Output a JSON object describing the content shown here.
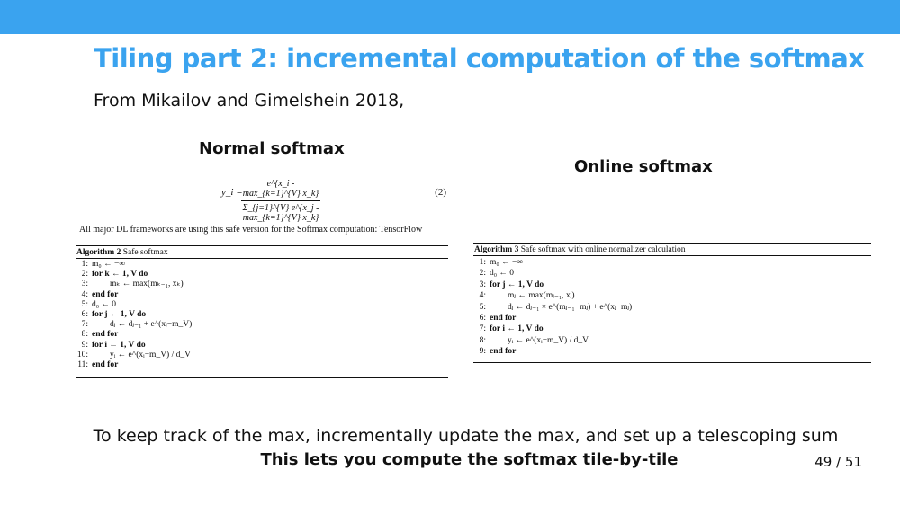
{
  "slide": {
    "title": "Tiling part 2: incremental computation of the softmax",
    "subtitle": "From Mikailov and Gimelshein 2018,",
    "left_heading": "Normal softmax",
    "right_heading": "Online softmax",
    "footer_line1": "To keep track of the max, incrementally update the max, and set up a telescoping sum",
    "footer_line2": "This lets you compute the softmax tile-by-tile",
    "page_number": "49 / 51"
  },
  "equation": {
    "lhs": "y_i =",
    "numerator": "e^{x_i - max_{k=1}^{V} x_k}",
    "denominator": "Σ_{j=1}^{V} e^{x_j - max_{k=1}^{V} x_k}",
    "number": "(2)"
  },
  "note": "All major DL frameworks are using this safe version for the Softmax computation: TensorFlow",
  "algo_left": {
    "label": "Algorithm 2",
    "caption": "Safe softmax",
    "lines": [
      {
        "n": "1:",
        "text": "m₀ ← −∞"
      },
      {
        "n": "2:",
        "text": "for k ← 1, V do"
      },
      {
        "n": "3:",
        "text": "mₖ ← max(mₖ₋₁, xₖ)"
      },
      {
        "n": "4:",
        "text": "end for"
      },
      {
        "n": "5:",
        "text": "d₀ ← 0"
      },
      {
        "n": "6:",
        "text": "for j ← 1, V do"
      },
      {
        "n": "7:",
        "text": "dⱼ ← dⱼ₋₁ + e^(xⱼ−m_V)"
      },
      {
        "n": "8:",
        "text": "end for"
      },
      {
        "n": "9:",
        "text": "for i ← 1, V do"
      },
      {
        "n": "10:",
        "text": "yᵢ ← e^(xᵢ−m_V) / d_V"
      },
      {
        "n": "11:",
        "text": "end for"
      }
    ]
  },
  "algo_right": {
    "label": "Algorithm 3",
    "caption": "Safe softmax with online normalizer calculation",
    "lines": [
      {
        "n": "1:",
        "text": "m₀ ← −∞"
      },
      {
        "n": "2:",
        "text": "d₀ ← 0"
      },
      {
        "n": "3:",
        "text": "for j ← 1, V do"
      },
      {
        "n": "4:",
        "text": "mⱼ ← max(mⱼ₋₁, xⱼ)"
      },
      {
        "n": "5:",
        "text": "dⱼ ← dⱼ₋₁ × e^(mⱼ₋₁−mⱼ) + e^(xⱼ−mⱼ)"
      },
      {
        "n": "6:",
        "text": "end for"
      },
      {
        "n": "7:",
        "text": "for i ← 1, V do"
      },
      {
        "n": "8:",
        "text": "yᵢ ← e^(xᵢ−m_V) / d_V"
      },
      {
        "n": "9:",
        "text": "end for"
      }
    ]
  }
}
